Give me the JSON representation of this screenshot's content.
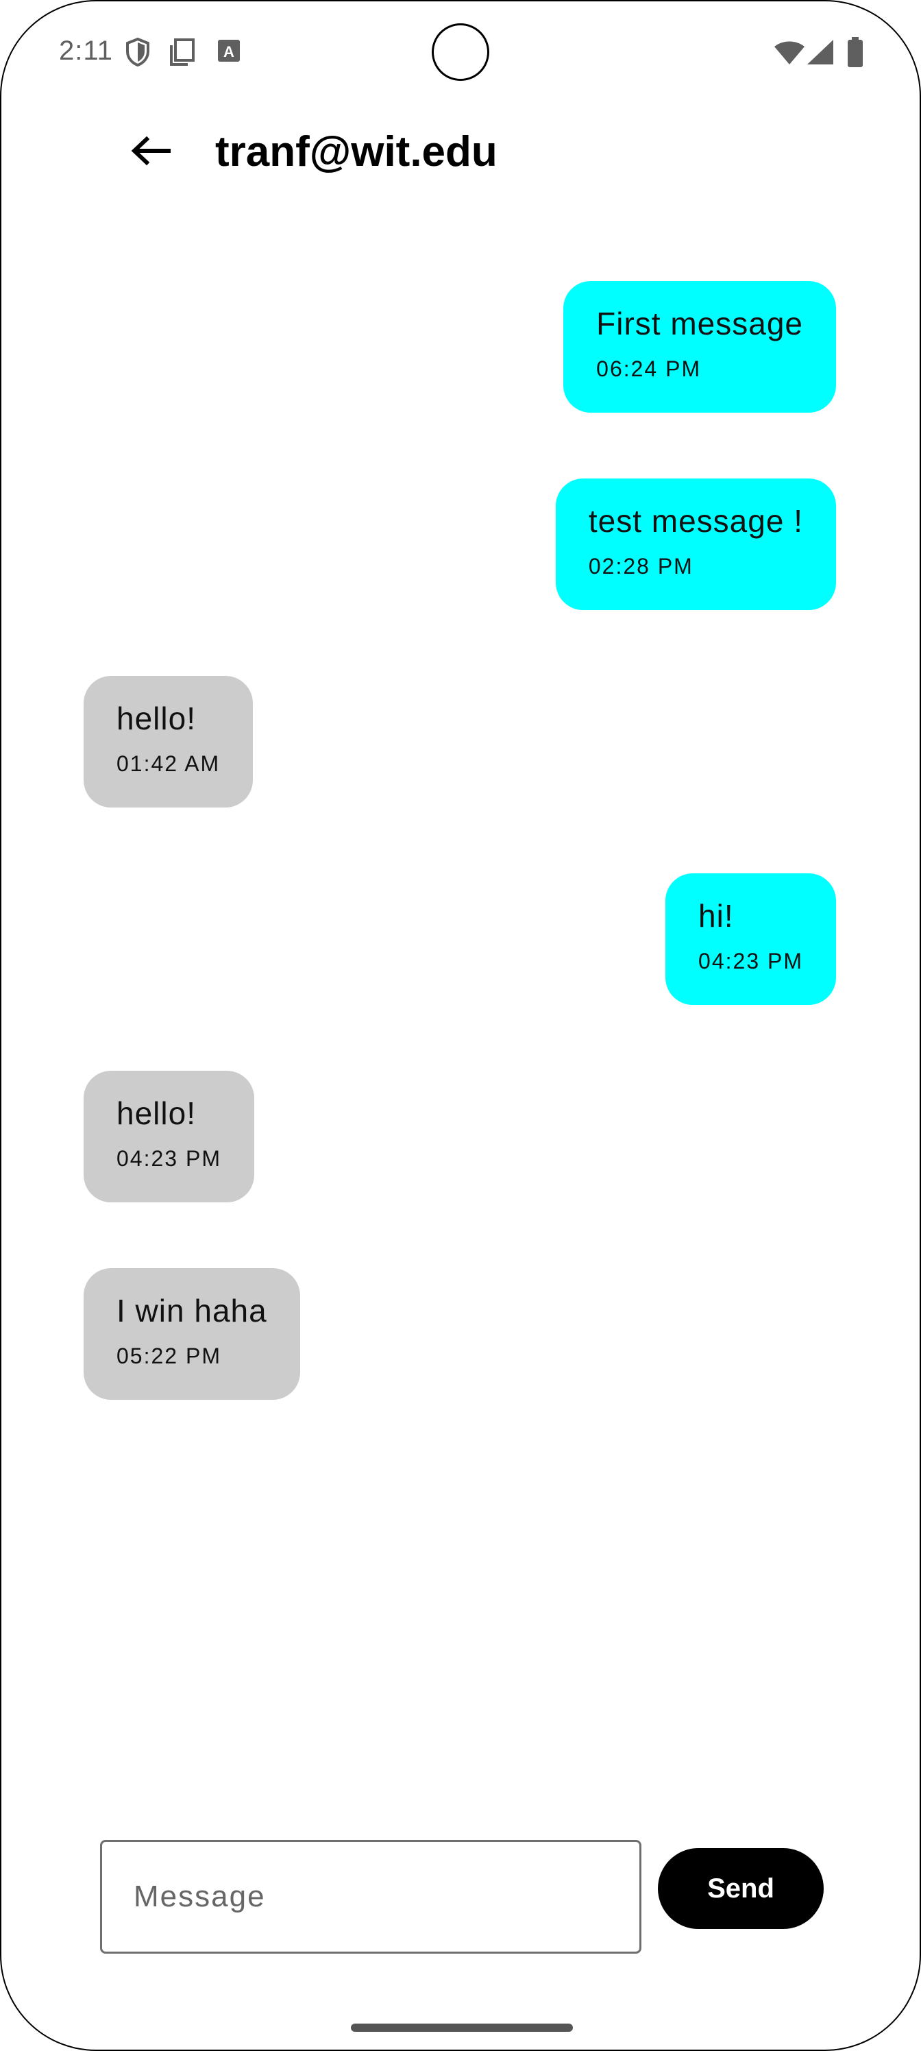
{
  "status_bar": {
    "time": "2:11",
    "icons_left": [
      "shield-icon",
      "copy-icon",
      "text-a-icon"
    ],
    "icons_right": [
      "wifi-icon",
      "cell-signal-icon",
      "battery-icon"
    ]
  },
  "header": {
    "title": "tranf@wit.edu",
    "back_icon": "arrow-left-icon"
  },
  "messages": [
    {
      "text": "First message",
      "time": "06:24 PM",
      "side": "sent"
    },
    {
      "text": "test message !",
      "time": "02:28 PM",
      "side": "sent"
    },
    {
      "text": "hello!",
      "time": "01:42 AM",
      "side": "received"
    },
    {
      "text": "hi!",
      "time": "04:23 PM",
      "side": "sent"
    },
    {
      "text": "hello!",
      "time": "04:23 PM",
      "side": "received"
    },
    {
      "text": "I win haha",
      "time": "05:22 PM",
      "side": "received"
    }
  ],
  "composer": {
    "placeholder": "Message",
    "value": "",
    "send_label": "Send"
  },
  "colors": {
    "sent_bubble": "#00ffff",
    "received_bubble": "#cccccc",
    "send_button": "#000000"
  }
}
